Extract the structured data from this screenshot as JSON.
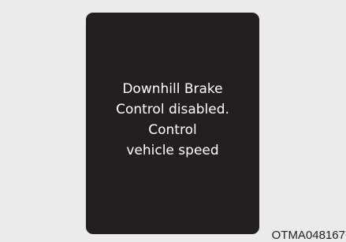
{
  "display": {
    "message_lines": [
      "Downhill Brake",
      "Control disabled.",
      "Control",
      "vehicle speed"
    ]
  },
  "image_code": "OTMA048167",
  "colors": {
    "background": "#ebebeb",
    "panel": "#231f20",
    "text": "#ffffff"
  }
}
